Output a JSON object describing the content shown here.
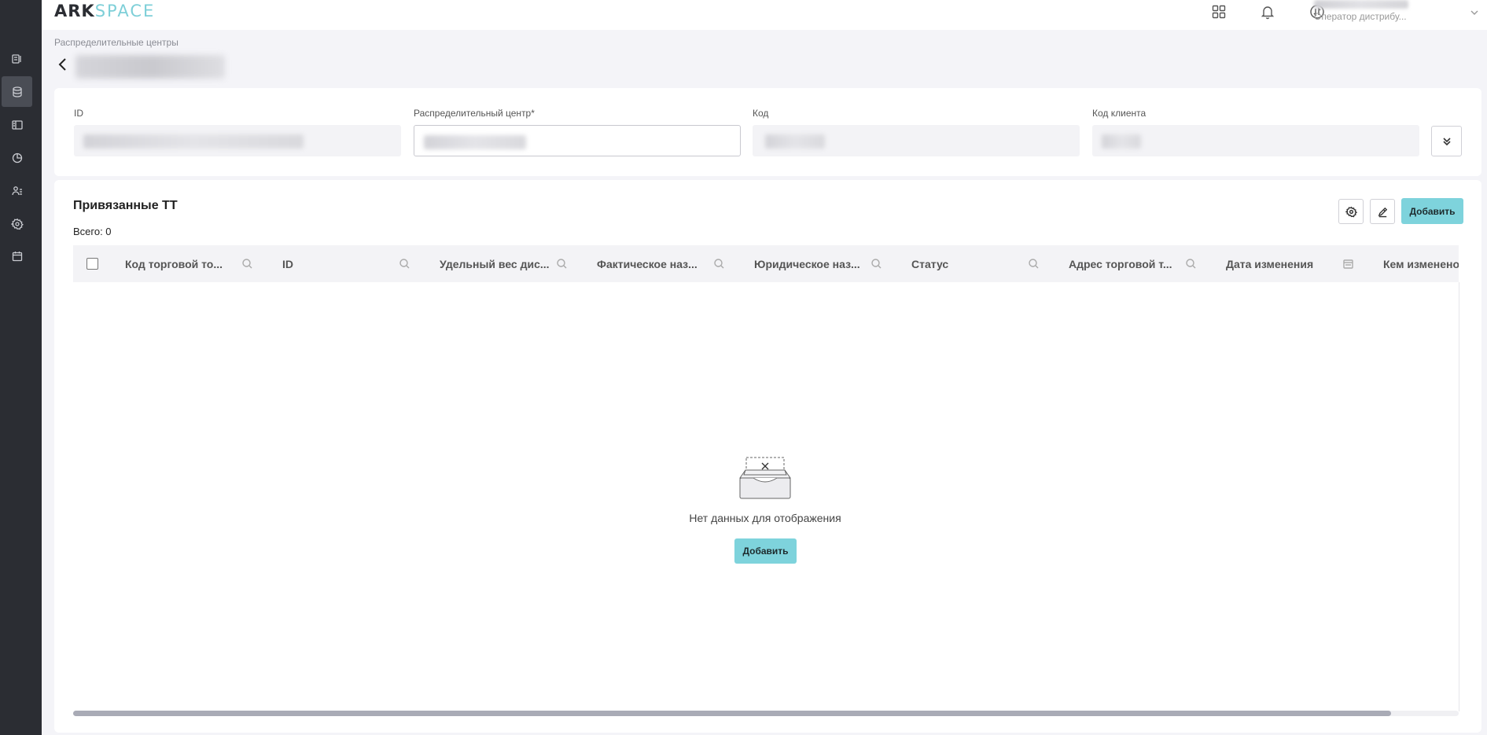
{
  "app": {
    "logo_part1": "ARK",
    "logo_part2": "SPACE",
    "accent_color": "#7ed3dc"
  },
  "sidebar": {
    "items": [
      {
        "name": "reports-icon"
      },
      {
        "name": "database-icon",
        "active": true
      },
      {
        "name": "layout-icon"
      },
      {
        "name": "chart-pie-icon"
      },
      {
        "name": "users-icon"
      },
      {
        "name": "settings-icon"
      },
      {
        "name": "calendar-icon"
      }
    ]
  },
  "header": {
    "icons": [
      "apps-grid-icon",
      "bell-icon",
      "sync-icon"
    ],
    "user_role": "Оператор дистрибу..."
  },
  "breadcrumb": "Распределительные центры",
  "form": {
    "id_label": "ID",
    "dc_label": "Распределительный центр*",
    "code_label": "Код",
    "client_code_label": "Код клиента"
  },
  "section": {
    "title": "Привязанные ТТ",
    "total": "Всего: 0",
    "add_label": "Добавить"
  },
  "table": {
    "columns": [
      "Код торговой то...",
      "ID",
      "Удельный вес дис...",
      "Фактическое наз...",
      "Юридическое наз...",
      "Статус",
      "Адрес торговой т...",
      "Дата изменения",
      "Кем изменено"
    ]
  },
  "empty": {
    "message": "Нет данных для отображения",
    "add_label": "Добавить"
  }
}
